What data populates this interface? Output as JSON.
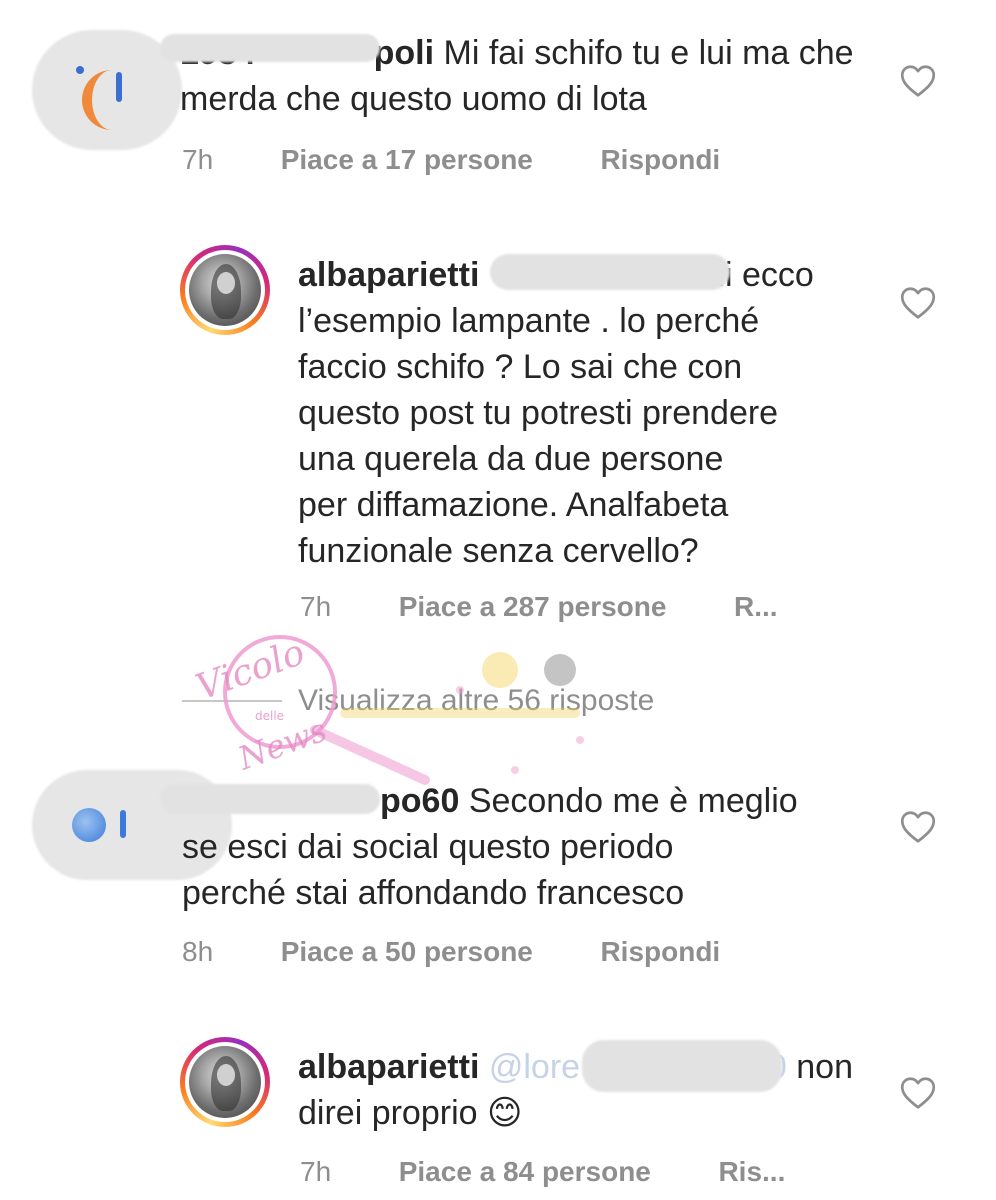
{
  "comments": [
    {
      "username_visible": "1934",
      "username_tail": "poli",
      "text_line1": "Mi fai schifo tu e lui ma che",
      "text_line2": "merda che questo uomo di lota",
      "time": "7h",
      "likes": "Piace a 17 persone",
      "reply": "Rispondi"
    },
    {
      "username": "albaparietti",
      "mention_tail": "li",
      "text_line1": "ecco",
      "text_line2": "l’esempio lampante . lo perché",
      "text_line3": "faccio schifo ? Lo sai che con",
      "text_line4": "questo post tu potresti prendere",
      "text_line5": "una querela da due persone",
      "text_line6": "per diffamazione. Analfabeta",
      "text_line7": "funzionale senza cervello?",
      "time": "7h",
      "likes": "Piace a 287 persone",
      "reply": "R..."
    },
    {
      "username_tail": "po60",
      "text_line1": "Secondo me è  meglio",
      "text_line2": "se esci dai social questo periodo",
      "text_line3": "perché  stai affondando francesco",
      "time": "8h",
      "likes": "Piace a 50 persone",
      "reply": "Rispondi"
    },
    {
      "username": "albaparietti",
      "mention_head": "@lore",
      "mention_tail": "600",
      "text_line1": "non",
      "text_line2": "direi proprio",
      "emoji": "😊",
      "time": "7h",
      "likes": "Piace a 84 persone",
      "reply": "Ris..."
    }
  ],
  "view_more": "Visualizza altre 56 risposte",
  "watermark": {
    "line1": "Vicolo",
    "line2": "delle",
    "line3": "News"
  },
  "icons": {
    "like": "heart-outline-icon",
    "avatar": "profile-avatar"
  },
  "colors": {
    "text": "#262626",
    "meta": "#8e8e8e",
    "redaction": "#e4e4e4",
    "watermark_pink": "#e8a0c8"
  }
}
